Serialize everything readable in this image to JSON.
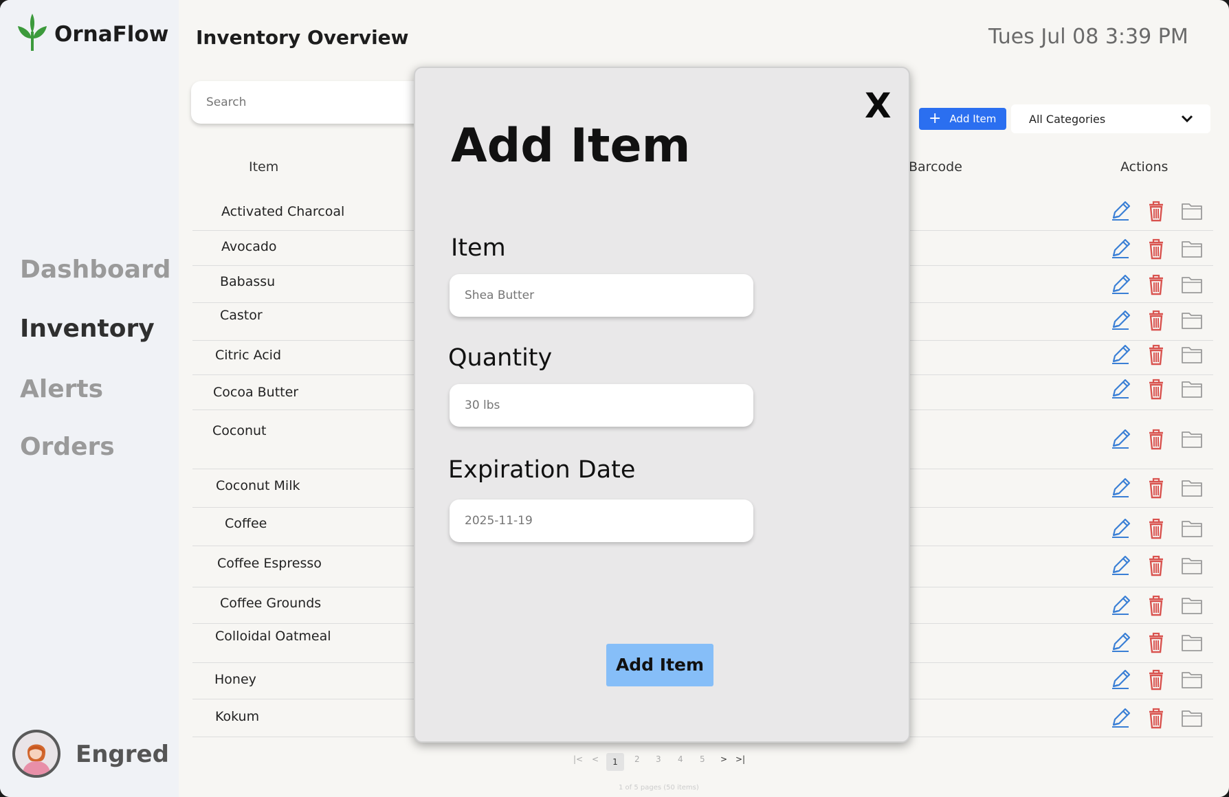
{
  "app": {
    "name": "OrnaFlow"
  },
  "sidebar": {
    "items": [
      {
        "label": "Dashboard",
        "active": false
      },
      {
        "label": "Inventory",
        "active": true
      },
      {
        "label": "Alerts",
        "active": false
      },
      {
        "label": "Orders",
        "active": false
      }
    ],
    "user": {
      "name": "Engred"
    }
  },
  "header": {
    "title": "Inventory Overview",
    "datetime": "Tues Jul 08 3:39 PM"
  },
  "toolbar": {
    "search_placeholder": "Search",
    "add_item_label": "Add Item",
    "category_selected": "All Categories"
  },
  "table": {
    "columns": {
      "item": "Item",
      "barcode": "Barcode",
      "actions": "Actions"
    },
    "rows": [
      "Activated Charcoal",
      "Avocado",
      "Babassu",
      "Castor",
      "Citric Acid",
      "Cocoa Butter",
      "Coconut",
      "Coconut Milk",
      "Coffee",
      "Coffee Espresso",
      "Coffee Grounds",
      "Colloidal Oatmeal",
      "Honey",
      "Kokum"
    ]
  },
  "pagination": {
    "pages": [
      "1",
      "2",
      "3",
      "4",
      "5"
    ],
    "current": "1",
    "info": "1 of 5 pages (50 items)"
  },
  "modal": {
    "title": "Add Item",
    "close_label": "X",
    "fields": {
      "item": {
        "label": "Item",
        "placeholder": "Shea Butter"
      },
      "quantity": {
        "label": "Quantity",
        "placeholder": "30 lbs"
      },
      "expiration": {
        "label": "Expiration Date",
        "placeholder": "2025-11-19"
      }
    },
    "submit_label": "Add Item"
  },
  "colors": {
    "accent": "#2b6ff0",
    "submit": "#86bef8",
    "edit_icon": "#3a7fd5",
    "delete_icon": "#d9534f",
    "folder_icon": "#9a9a9a",
    "logo_green": "#3c9a3c"
  },
  "icons": [
    "leaf-logo-icon",
    "plus-icon",
    "chevron-down-icon",
    "pencil-icon",
    "trash-icon",
    "folder-icon",
    "close-icon"
  ]
}
